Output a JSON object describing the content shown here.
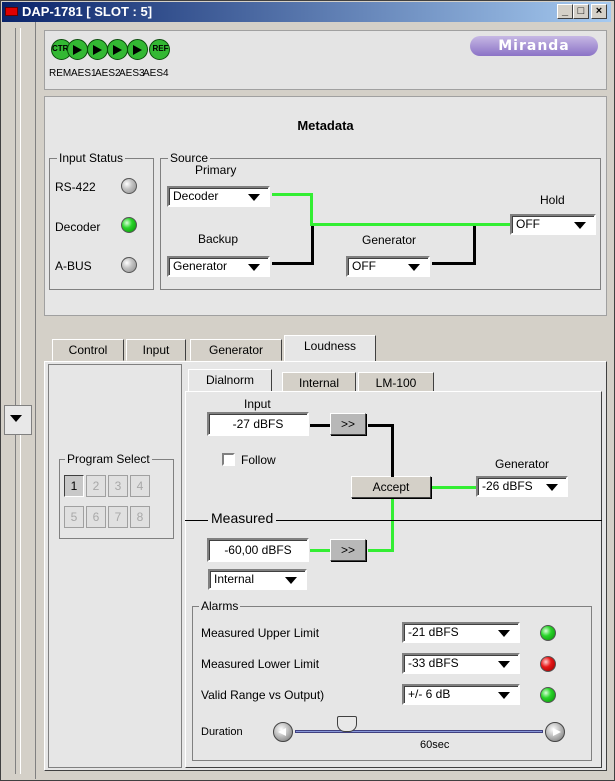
{
  "window": {
    "title": "DAP-1781 [ SLOT : 5]",
    "minimize": "_",
    "maximize": "□",
    "close": "×"
  },
  "header": {
    "icons": [
      {
        "id": "ctrl",
        "text": "CTRL",
        "label": "REM"
      },
      {
        "id": "aes1",
        "text": "",
        "label": "AES1"
      },
      {
        "id": "aes2",
        "text": "",
        "label": "AES2"
      },
      {
        "id": "aes3",
        "text": "",
        "label": "AES3"
      },
      {
        "id": "aes4",
        "text": "",
        "label": "AES4"
      },
      {
        "id": "ref",
        "text": "REF",
        "label": ""
      }
    ],
    "logo": "Miranda"
  },
  "metadata": {
    "title": "Metadata",
    "input_status": {
      "title": "Input Status",
      "items": [
        {
          "label": "RS-422",
          "status": "gray"
        },
        {
          "label": "Decoder",
          "status": "green"
        },
        {
          "label": "A-BUS",
          "status": "gray"
        }
      ]
    },
    "source": {
      "title": "Source",
      "primary_label": "Primary",
      "primary_value": "Decoder",
      "backup_label": "Backup",
      "backup_value": "Generator",
      "generator_label": "Generator",
      "generator_value": "OFF",
      "hold_label": "Hold",
      "hold_value": "OFF"
    }
  },
  "tabs": [
    "Control",
    "Input",
    "Generator",
    "Loudness"
  ],
  "active_tab": "Loudness",
  "program_select": {
    "title": "Program Select",
    "buttons": [
      "1",
      "2",
      "3",
      "4",
      "5",
      "6",
      "7",
      "8"
    ],
    "selected": "1"
  },
  "subtabs": [
    "Dialnorm",
    "Internal",
    "LM-100"
  ],
  "active_subtab": "Dialnorm",
  "dialnorm": {
    "input_label": "Input",
    "input_value": "-27 dBFS",
    "arrow_button": ">>",
    "follow_label": "Follow",
    "follow_checked": false,
    "accept_label": "Accept",
    "generator_label": "Generator",
    "generator_value": "-26 dBFS",
    "measured_label": "Measured",
    "measured_value": "-60,00 dBFS",
    "measured_arrow": ">>",
    "measure_source": "Internal"
  },
  "alarms": {
    "title": "Alarms",
    "rows": [
      {
        "label": "Measured Upper Limit",
        "value": "-21 dBFS",
        "status": "green"
      },
      {
        "label": "Measured Lower Limit",
        "value": "-33 dBFS",
        "status": "red"
      },
      {
        "label": "Valid Range vs Output)",
        "value": "+/- 6 dB",
        "status": "green"
      }
    ],
    "duration_label": "Duration",
    "duration_value": "60sec",
    "duration_fraction": 0.21
  },
  "colors": {
    "link_green": "#33ee33",
    "link_black": "#000000",
    "title_start": "#0a246a",
    "title_end": "#a6caf0"
  }
}
